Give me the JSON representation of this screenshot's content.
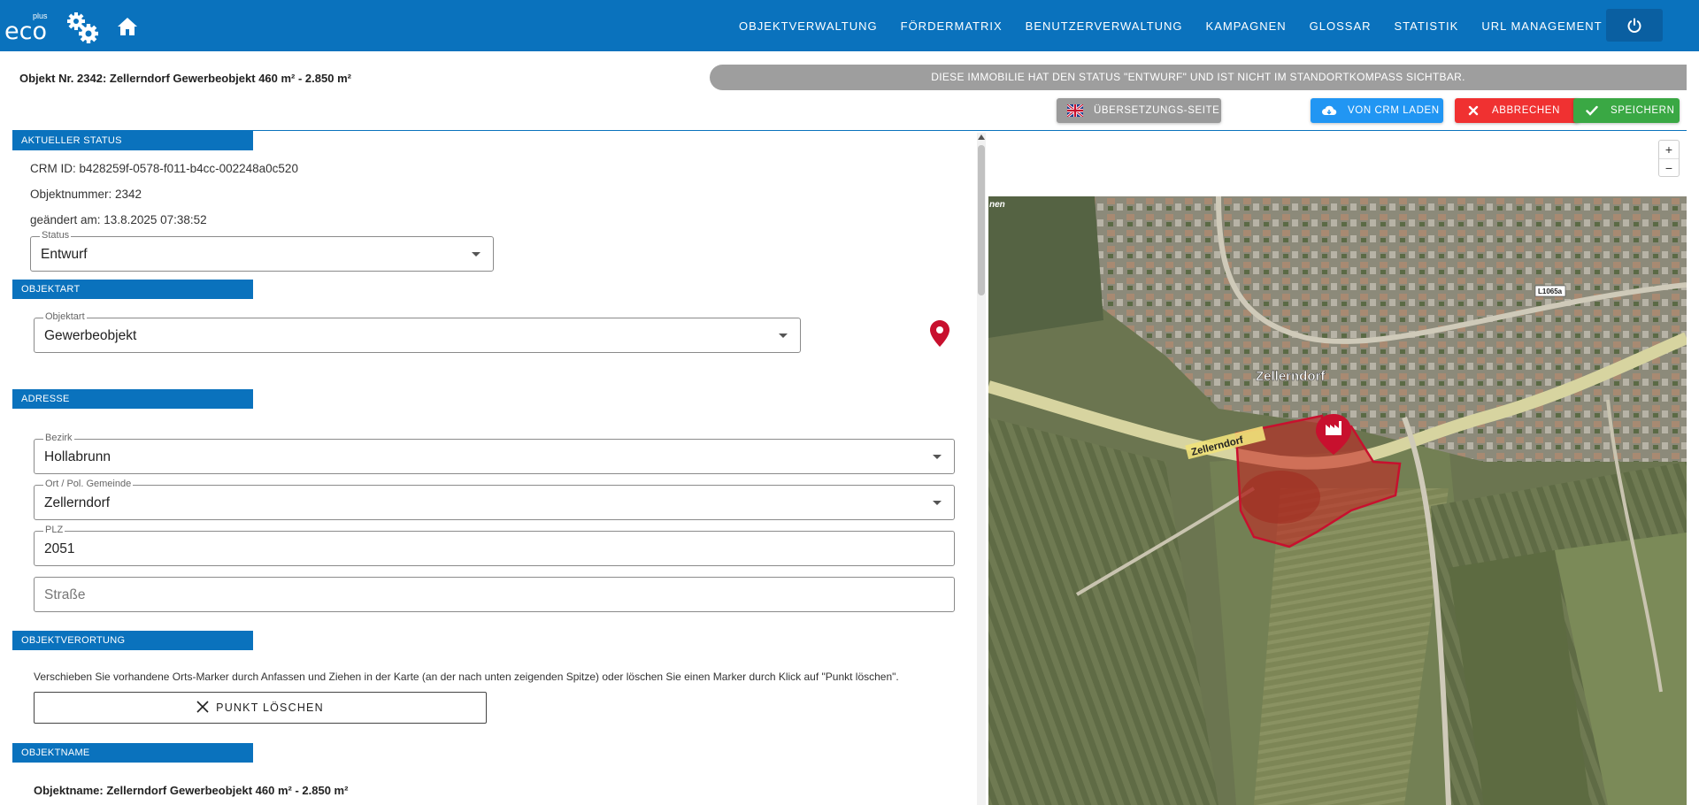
{
  "nav": {
    "logo_text": "eco",
    "logo_sup": "plus",
    "links": [
      "OBJEKTVERWALTUNG",
      "FÖRDERMATRIX",
      "BENUTZERVERWALTUNG",
      "KAMPAGNEN",
      "GLOSSAR",
      "STATISTIK",
      "URL MANAGEMENT"
    ]
  },
  "header": {
    "title": "Objekt Nr. 2342: Zellerndorf Gewerbeobjekt 460 m² - 2.850 m²",
    "status_banner": "DIESE IMMOBILIE HAT DEN STATUS \"ENTWURF\" UND IST NICHT IM STANDORTKOMPASS SICHTBAR."
  },
  "actions": {
    "translate": "ÜBERSETZUNGS-SEITE ANZEIGEN",
    "crm": "VON CRM LADEN",
    "cancel": "ABBRECHEN",
    "save": "SPEICHERN"
  },
  "sections": {
    "status": "AKTUELLER STATUS",
    "objektart": "OBJEKTART",
    "adresse": "ADRESSE",
    "verortung": "OBJEKTVERORTUNG",
    "objektname": "OBJEKTNAME"
  },
  "status": {
    "crm_id": "CRM ID: b428259f-0578-f011-b4cc-002248a0c520",
    "objektnummer": "Objektnummer: 2342",
    "geaendert": "geändert am: 13.8.2025 07:38:52",
    "status_label": "Status",
    "status_value": "Entwurf"
  },
  "objektart": {
    "label": "Objektart",
    "value": "Gewerbeobjekt"
  },
  "adresse": {
    "bezirk_label": "Bezirk",
    "bezirk_value": "Hollabrunn",
    "ort_label": "Ort / Pol. Gemeinde",
    "ort_value": "Zellerndorf",
    "plz_label": "PLZ",
    "plz_value": "2051",
    "strasse_placeholder": "Straße"
  },
  "verortung": {
    "hint": "Verschieben Sie vorhandene Orts-Marker durch Anfassen und Ziehen in der Karte (an der nach unten zeigenden Spitze) oder löschen Sie einen Marker durch Klick auf \"Punkt löschen\".",
    "delete_label": "PUNKT LÖSCHEN"
  },
  "objektname": {
    "text": "Objektname: Zellerndorf Gewerbeobjekt 460 m² - 2.850 m²"
  },
  "map": {
    "town_label": "Zellerndorf",
    "road_label": "Zellerndorf",
    "road_code": "L1065a",
    "edge_label": "nen",
    "zoom_in": "+",
    "zoom_out": "−"
  },
  "colors": {
    "primary": "#0a72bd",
    "save": "#3aa844",
    "cancel": "#f03131",
    "crm": "#2196f3",
    "banner": "#9e9e9e",
    "marker": "#c8102e"
  }
}
